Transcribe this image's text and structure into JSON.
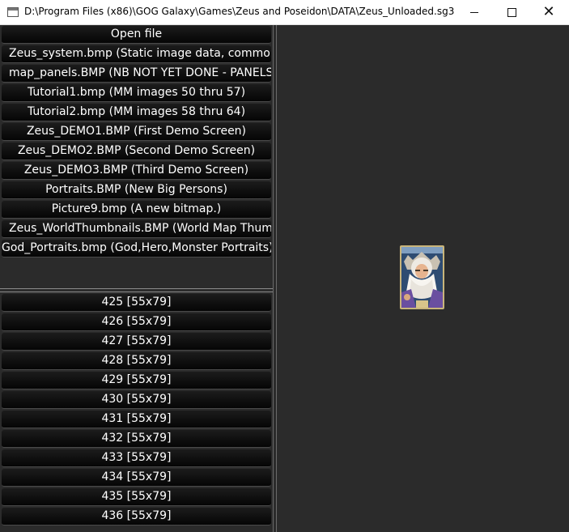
{
  "window": {
    "title": "D:\\Program Files (x86)\\GOG Galaxy\\Games\\Zeus and Poseidon\\DATA\\Zeus_Unloaded.sg3",
    "controls": {
      "minimize": "minimize",
      "maximize": "maximize",
      "close": "close"
    }
  },
  "files": {
    "open_label": "Open file",
    "items": [
      "Zeus_system.bmp (Static image data, common to",
      "map_panels.BMP (NB NOT YET DONE  - PANELS F",
      "Tutorial1.bmp (MM images 50 thru 57)",
      "Tutorial2.bmp (MM images 58 thru 64)",
      "Zeus_DEMO1.BMP (First Demo Screen)",
      "Zeus_DEMO2.BMP (Second Demo Screen)",
      "Zeus_DEMO3.BMP (Third Demo Screen)",
      "Portraits.BMP (New Big Persons)",
      "Picture9.bmp (A new bitmap.)",
      "Zeus_WorldThumbnails.BMP (World Map Thumbs",
      "God_Portraits.bmp (God,Hero,Monster Portraits)"
    ]
  },
  "images": {
    "items": [
      "425 [55x79]",
      "426 [55x79]",
      "427 [55x79]",
      "428 [55x79]",
      "429 [55x79]",
      "430 [55x79]",
      "431 [55x79]",
      "432 [55x79]",
      "433 [55x79]",
      "434 [55x79]",
      "435 [55x79]",
      "436 [55x79]"
    ]
  }
}
